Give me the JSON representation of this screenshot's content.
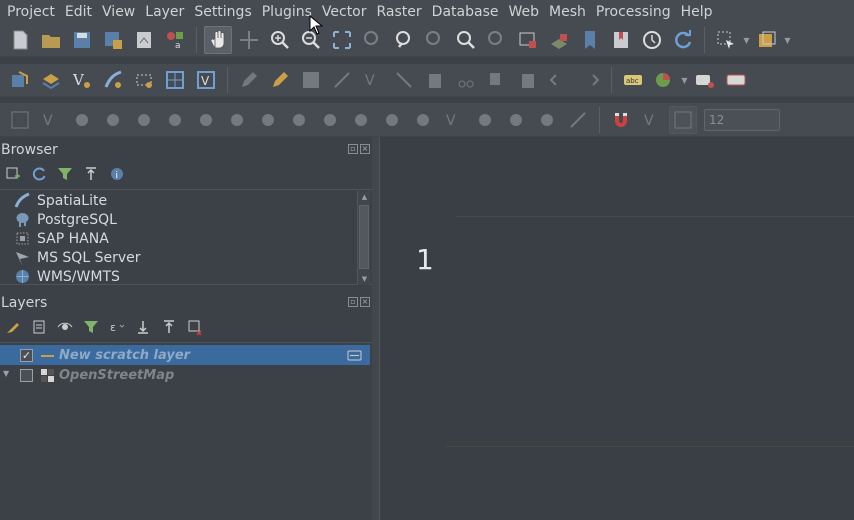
{
  "menubar": {
    "items": [
      "Project",
      "Edit",
      "View",
      "Layer",
      "Settings",
      "Plugins",
      "Vector",
      "Raster",
      "Database",
      "Web",
      "Mesh",
      "Processing",
      "Help"
    ]
  },
  "toolbar3": {
    "field_value": "12"
  },
  "browser": {
    "title": "Browser",
    "items": [
      "SpatiaLite",
      "PostgreSQL",
      "SAP HANA",
      "MS SQL Server",
      "WMS/WMTS"
    ]
  },
  "layers": {
    "title": "Layers",
    "rows": [
      {
        "label": "New scratch layer",
        "checked": "✓"
      },
      {
        "label": "OpenStreetMap",
        "checked": ""
      }
    ]
  },
  "canvas": {
    "label": "1"
  },
  "colors": {
    "accent_selection": "#3b6a9e",
    "background": "#3c4148"
  }
}
